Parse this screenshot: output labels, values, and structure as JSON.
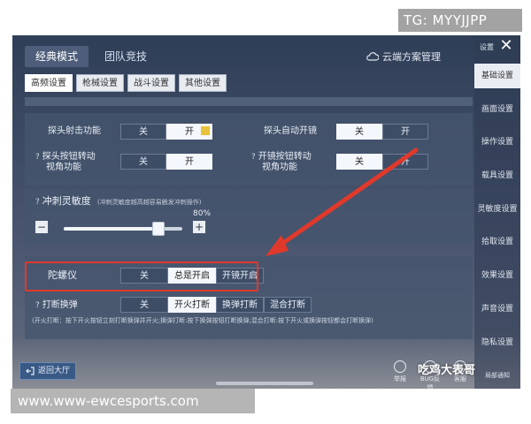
{
  "watermark_top": "TG: MYYJJPP",
  "watermark_bottom": "www.www-ewcesports.com",
  "top_tabs": [
    "经典模式",
    "团队竞技"
  ],
  "cloud_label": "云端方案管理",
  "sub_tabs": [
    "高频设置",
    "枪械设置",
    "战斗设置",
    "其他设置"
  ],
  "settings": {
    "peek_fire": {
      "label": "探头射击功能",
      "options": [
        "关",
        "开"
      ],
      "selected": 1
    },
    "peek_auto_scope": {
      "label": "探头自动开镜",
      "options": [
        "关",
        "开"
      ],
      "selected": 0
    },
    "peek_rotate": {
      "label_line1": "探头按钮转动",
      "label_line2": "视角功能",
      "options": [
        "关",
        "开"
      ],
      "selected": 1
    },
    "scope_rotate": {
      "label_line1": "开镜按钮转动",
      "label_line2": "视角功能",
      "options": [
        "关",
        "开"
      ],
      "selected": 0
    },
    "sprint": {
      "label": "冲刺灵敏度",
      "hint": "(冲刺灵敏度越高越容易触发冲刺操作)",
      "value": "80%",
      "level": 0.8
    },
    "gyro": {
      "label": "陀螺仪",
      "options": [
        "关",
        "总是开启",
        "开镜开启"
      ],
      "selected": 1
    },
    "fire_mode": {
      "label": "打断换弹",
      "options": [
        "关",
        "开火打断",
        "换弹打断",
        "混合打断"
      ],
      "selected": 1,
      "desc": "(开火打断：按下开火按钮立刻打断换弹并开火;换弹打断:按下换弹按钮打断换弹;混合打断:按下开火或换弹按钮都会打断换弹)"
    }
  },
  "sidebar": {
    "top_label": "设置",
    "items": [
      "基础设置",
      "画面设置",
      "操作设置",
      "载具设置",
      "灵敏度设置",
      "拾取设置",
      "效果设置",
      "声音设置",
      "隐私设置",
      "局部通知"
    ],
    "active": 0
  },
  "back_label": "返回大厅",
  "bottom_icons": [
    "举报",
    "BUG反馈",
    "客服"
  ],
  "author": "吃鸡大表哥",
  "colors": {
    "highlight": "#e0392b",
    "arrow": "#e0392b"
  }
}
